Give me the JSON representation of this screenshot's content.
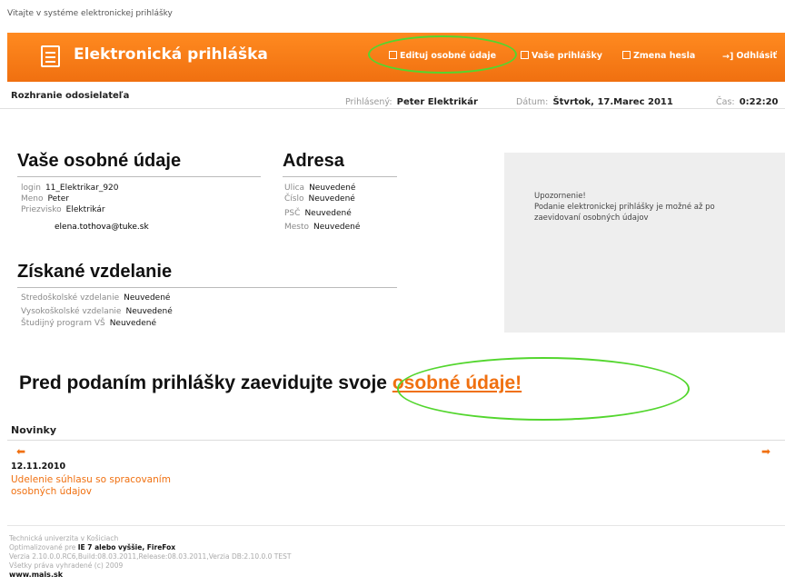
{
  "welcome": "Vitajte v systéme elektronickej prihlášky",
  "header": {
    "title": "Elektronická prihláška",
    "nav": {
      "edit": "Edituj osobné údaje",
      "applications": "Vaše prihlášky",
      "password": "Zmena hesla",
      "logout": "Odhlásiť"
    }
  },
  "infobar": {
    "subtitle": "Rozhranie odosielateľa",
    "user_label": "Prihlásený:",
    "user": "Peter Elektrikár",
    "date_label": "Dátum:",
    "date": "Štvrtok, 17.Marec 2011",
    "time_label": "Čas:",
    "time": "0:22:20"
  },
  "personal": {
    "title": "Vaše osobné údaje",
    "login_label": "login",
    "login": "11_Elektrikar_920",
    "name_label": "Meno",
    "name": "Peter",
    "surname_label": "Priezvisko",
    "surname": "Elektrikár",
    "email": "elena.tothova@tuke.sk"
  },
  "address": {
    "title": "Adresa",
    "street_label": "Ulica",
    "street": "Neuvedené",
    "number_label": "Číslo",
    "number": "Neuvedené",
    "zip_label": "PSČ",
    "zip": "Neuvedené",
    "city_label": "Mesto",
    "city": "Neuvedené"
  },
  "education": {
    "title": "Získané vzdelanie",
    "secondary_label": "Stredoškolské vzdelanie",
    "secondary": "Neuvedené",
    "university_label": "Vysokoškolské vzdelanie",
    "university": "Neuvedené",
    "program_label": "Študijný program VŠ",
    "program": "Neuvedené"
  },
  "notice": {
    "title": "Upozornenie!",
    "text_1": "Podanie elektronickej prihlášky je možné až po",
    "text_2": "zaevidovaní osobných údajov"
  },
  "cta": {
    "text": "Pred podaním prihlášky zaevidujte svoje ",
    "link": "osobné údaje!"
  },
  "news": {
    "title": "Novinky",
    "date": "12.11.2010",
    "link": "Udelenie súhlasu so spracovaním osobných údajov"
  },
  "footer": {
    "line1": "Technická univerzita v Košiciach",
    "line2_prefix": "Optimalizované pre",
    "line2_browsers": "IE 7 alebo vyššie, FireFox",
    "line3": "Verzia 2.10.0.0.RC6,Build:08.03.2011,Release:08.03.2011,Verzia DB:2.10.0.0 TEST",
    "line4": "Všetky práva vyhradené (c) 2009",
    "site": "www.mais.sk"
  },
  "colors": {
    "accent": "#f07010",
    "highlight_ring": "#53d62e",
    "notice_bg": "#eeeeee"
  }
}
